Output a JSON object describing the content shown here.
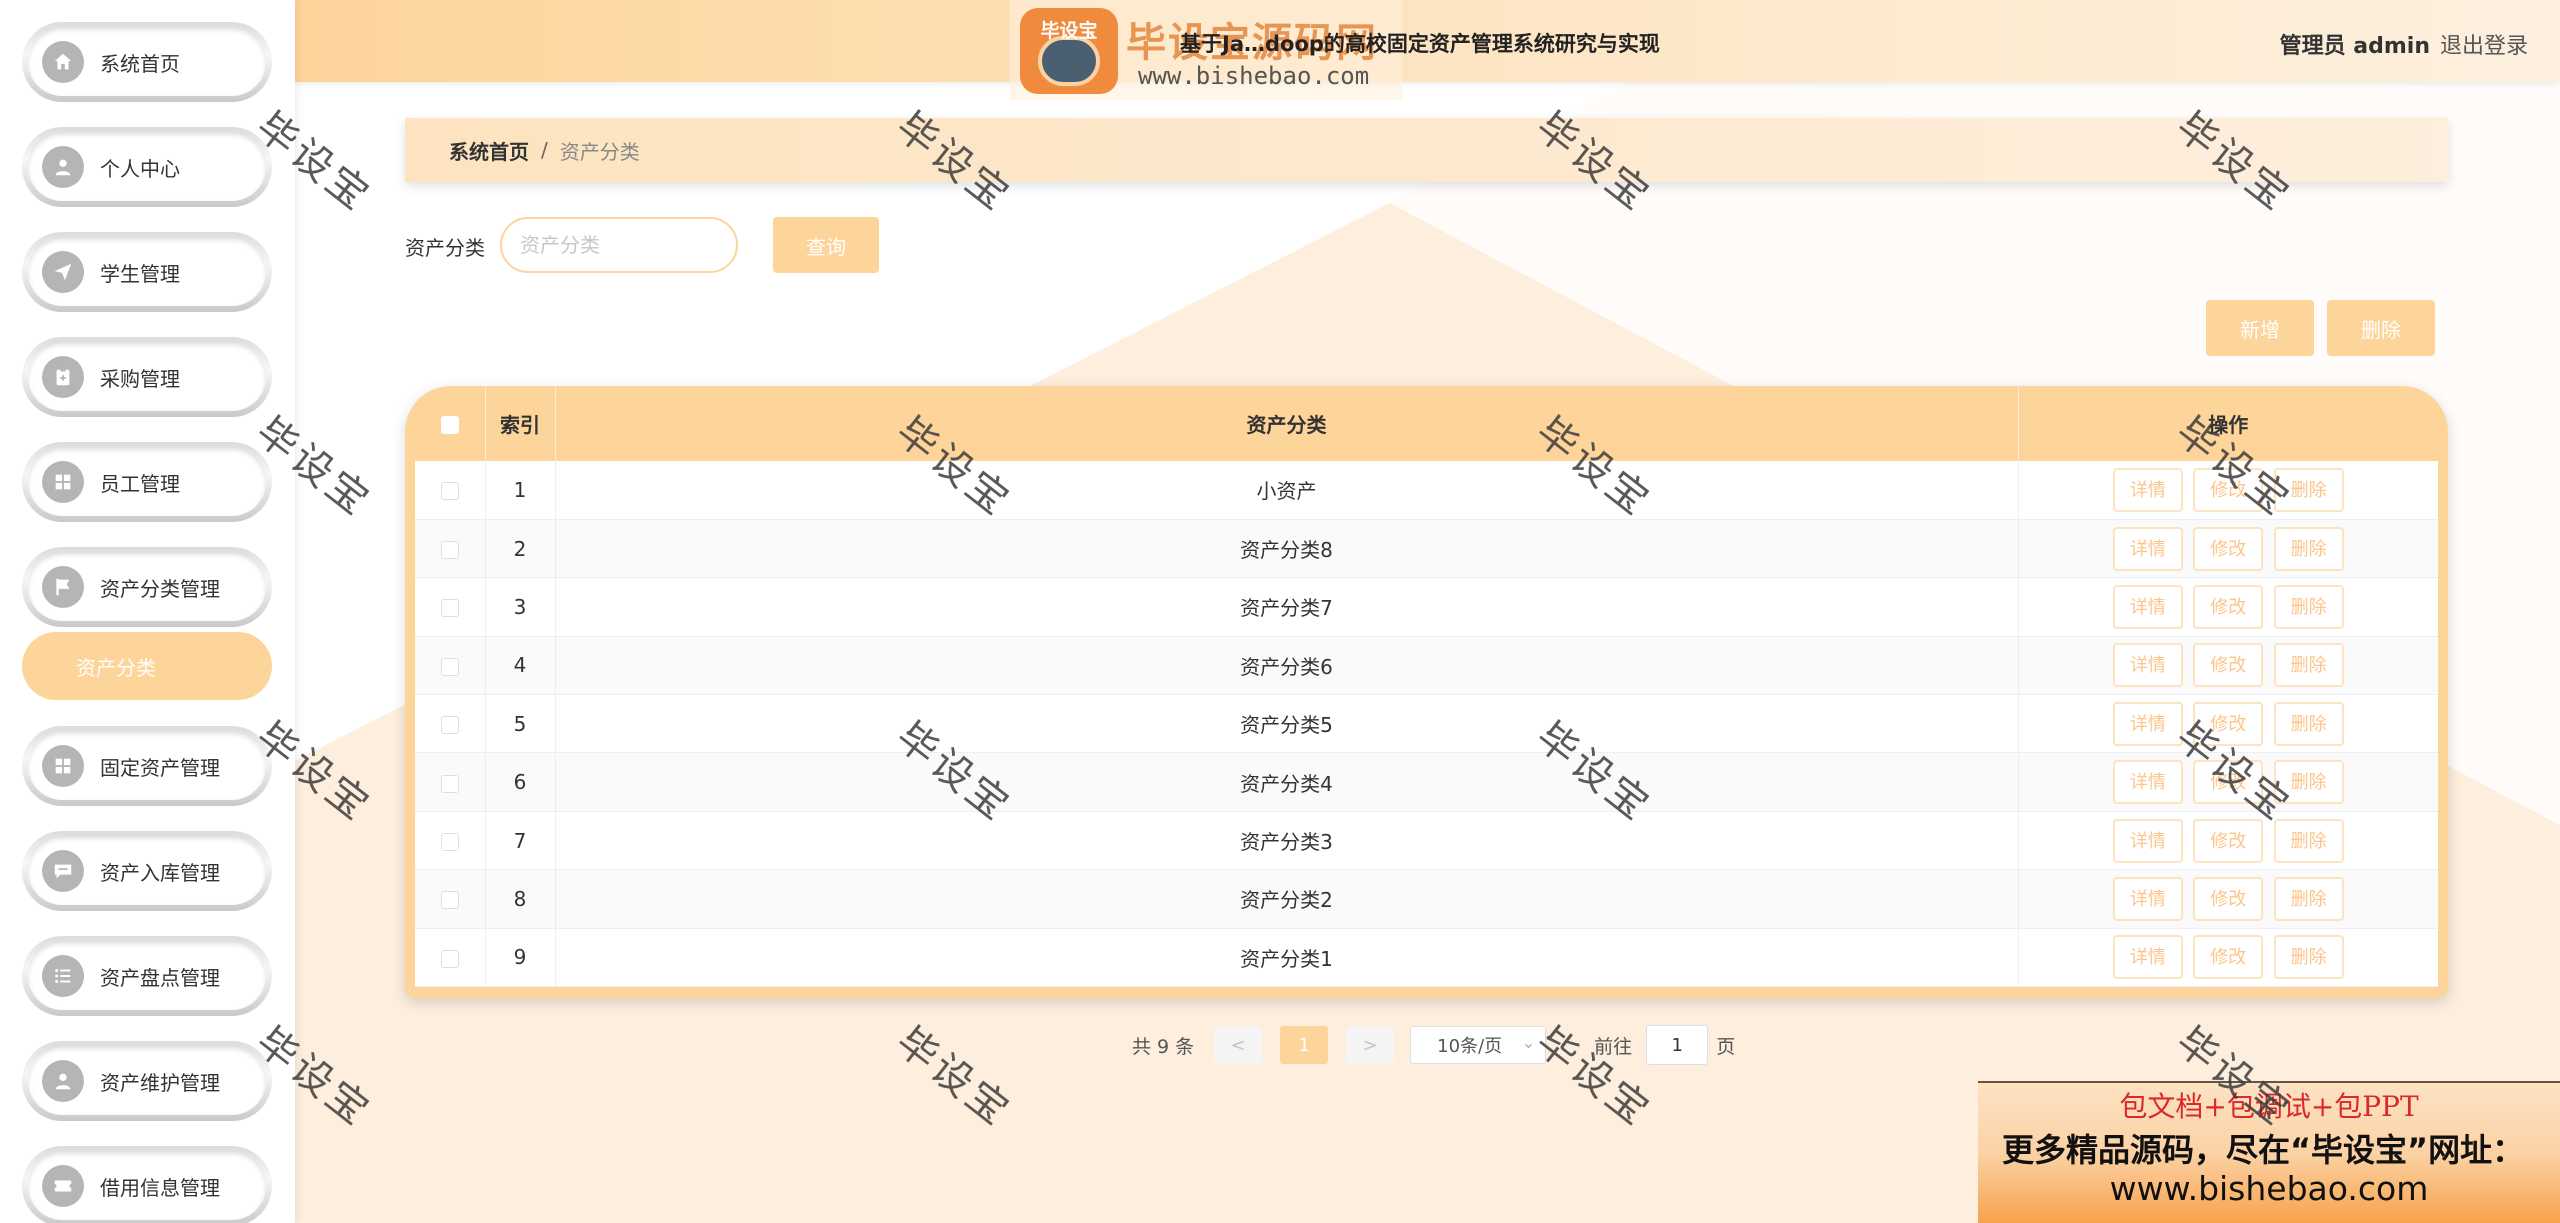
{
  "header": {
    "title": "基于Ja…doop的高校固定资产管理系统研究与实现",
    "user": "管理员 admin",
    "logout": "退出登录"
  },
  "logo": {
    "badge_text": "毕设宝",
    "brand": "毕设宝源码网",
    "url": "www.bishebao.com"
  },
  "sidebar": {
    "items": [
      {
        "label": "系统首页",
        "icon": "home-icon"
      },
      {
        "label": "个人中心",
        "icon": "user-icon"
      },
      {
        "label": "学生管理",
        "icon": "send-icon"
      },
      {
        "label": "采购管理",
        "icon": "clipboard-icon"
      },
      {
        "label": "员工管理",
        "icon": "grid-icon"
      },
      {
        "label": "资产分类管理",
        "icon": "flag-icon"
      },
      {
        "label": "固定资产管理",
        "icon": "grid-icon"
      },
      {
        "label": "资产入库管理",
        "icon": "chat-icon"
      },
      {
        "label": "资产盘点管理",
        "icon": "list-icon"
      },
      {
        "label": "资产维护管理",
        "icon": "user-icon"
      },
      {
        "label": "借用信息管理",
        "icon": "ticket-icon"
      }
    ],
    "sub_item": "资产分类"
  },
  "breadcrumb": {
    "home": "系统首页",
    "separator": "/",
    "current": "资产分类"
  },
  "search": {
    "label": "资产分类",
    "placeholder": "资产分类",
    "value": "",
    "query_button": "查询"
  },
  "toolbar": {
    "add": "新增",
    "delete": "删除"
  },
  "table": {
    "columns": [
      "索引",
      "资产分类",
      "操作"
    ],
    "rows": [
      {
        "index": "1",
        "category": "小资产"
      },
      {
        "index": "2",
        "category": "资产分类8"
      },
      {
        "index": "3",
        "category": "资产分类7"
      },
      {
        "index": "4",
        "category": "资产分类6"
      },
      {
        "index": "5",
        "category": "资产分类5"
      },
      {
        "index": "6",
        "category": "资产分类4"
      },
      {
        "index": "7",
        "category": "资产分类3"
      },
      {
        "index": "8",
        "category": "资产分类2"
      },
      {
        "index": "9",
        "category": "资产分类1"
      }
    ],
    "actions": {
      "detail": "详情",
      "edit": "修改",
      "delete": "删除"
    }
  },
  "pagination": {
    "total": "共 9 条",
    "prev": "<",
    "current": "1",
    "next": ">",
    "page_size": "10条/页",
    "goto": "前往",
    "goto_value": "1",
    "page_unit": "页"
  },
  "ad": {
    "line1": "包文档+包调试+包PPT",
    "line2": "更多精品源码，尽在“毕设宝”网址：",
    "line3": "www.bishebao.com"
  },
  "watermark": "毕设宝",
  "colors": {
    "accent": "#fdd49a",
    "accent_light": "#fdeedd",
    "ad_red": "#d9292a"
  }
}
